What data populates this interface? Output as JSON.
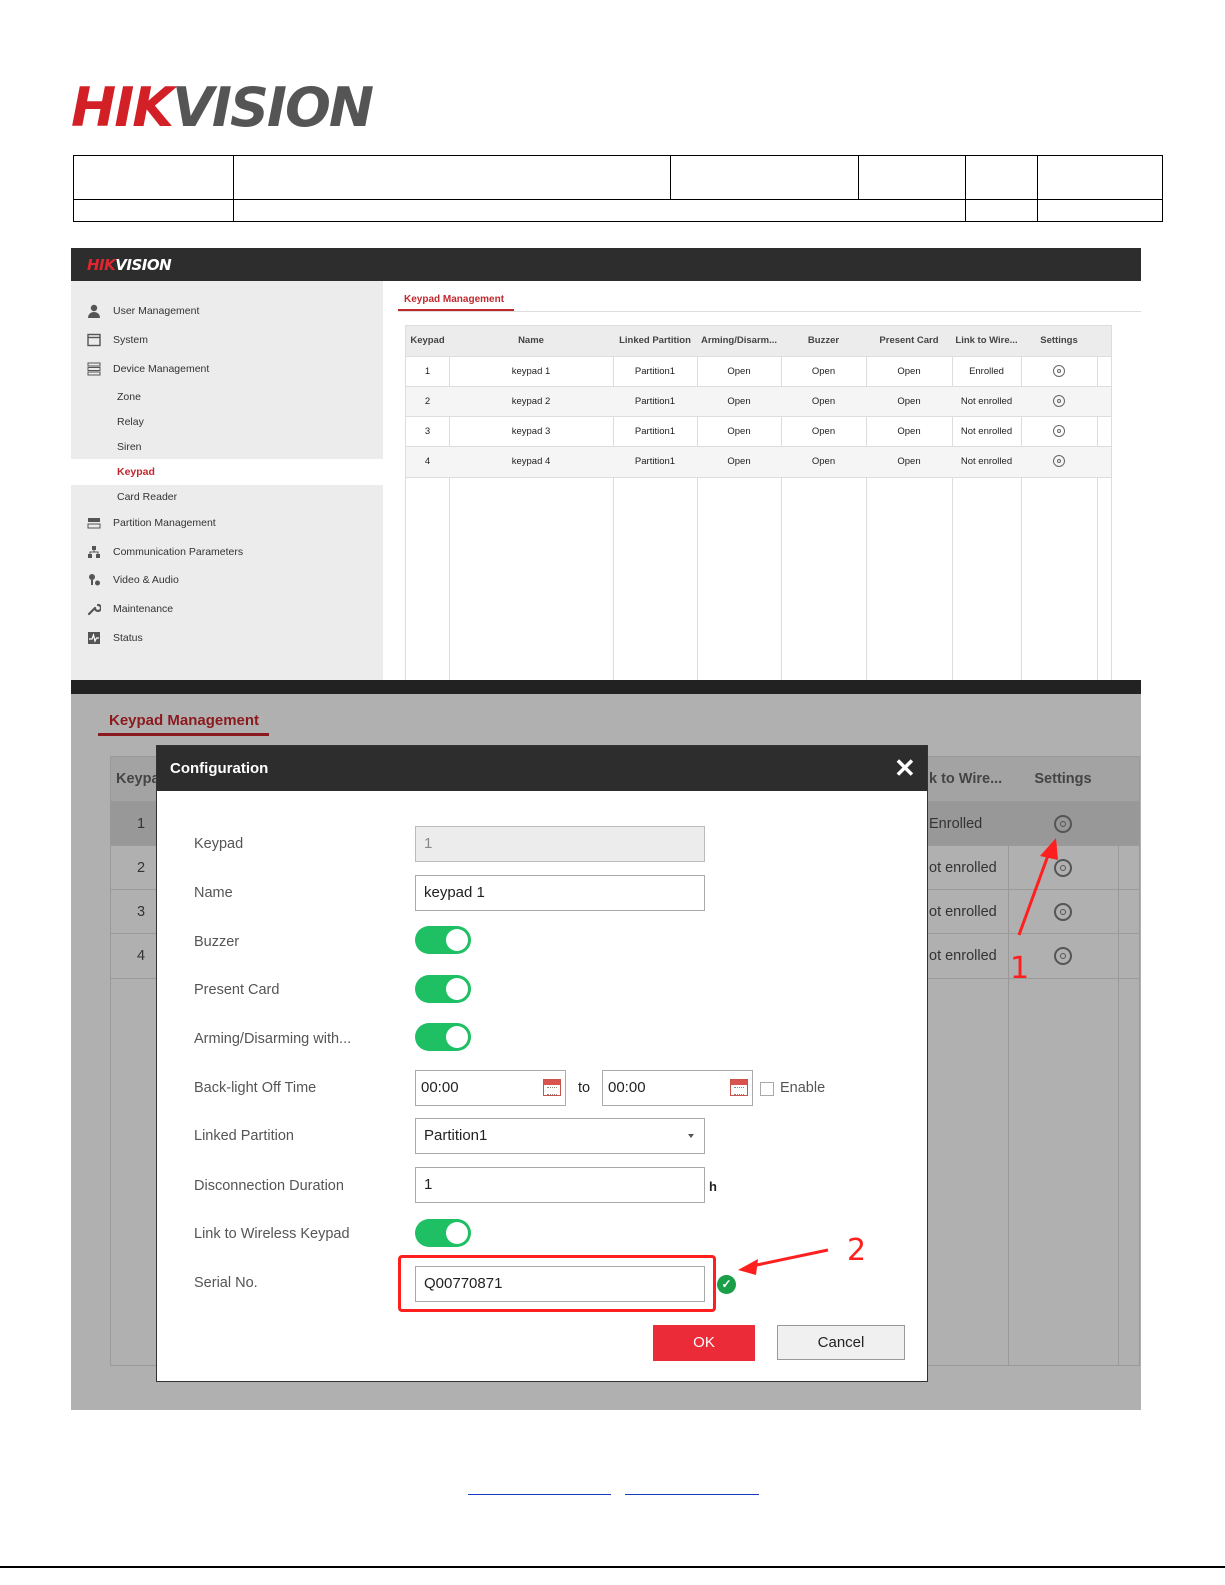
{
  "doc": {
    "logo_red": "HIK",
    "logo_gray": "VISION"
  },
  "app": {
    "logo_red": "HIK",
    "logo_white": "VISION",
    "sidebar": [
      {
        "label": "User Management",
        "icon": "user-icon",
        "level": "top"
      },
      {
        "label": "System",
        "icon": "window-icon",
        "level": "top"
      },
      {
        "label": "Device Management",
        "icon": "device-icon",
        "level": "top"
      },
      {
        "label": "Zone",
        "level": "sub"
      },
      {
        "label": "Relay",
        "level": "sub"
      },
      {
        "label": "Siren",
        "level": "sub"
      },
      {
        "label": "Keypad",
        "level": "sub",
        "active": true
      },
      {
        "label": "Card Reader",
        "level": "sub"
      },
      {
        "label": "Partition Management",
        "icon": "partition-icon",
        "level": "top"
      },
      {
        "label": "Communication Parameters",
        "icon": "network-icon",
        "level": "top"
      },
      {
        "label": "Video & Audio",
        "icon": "video-audio-icon",
        "level": "top"
      },
      {
        "label": "Maintenance",
        "icon": "wrench-icon",
        "level": "top"
      },
      {
        "label": "Status",
        "icon": "status-icon",
        "level": "top"
      }
    ],
    "tab_label": "Keypad Management",
    "columns": [
      "Keypad",
      "Name",
      "Linked Partition",
      "Arming/Disarm...",
      "Buzzer",
      "Present Card",
      "Link to Wire...",
      "Settings"
    ],
    "rows": [
      {
        "keypad": "1",
        "name": "keypad 1",
        "partition": "Partition1",
        "arming": "Open",
        "buzzer": "Open",
        "card": "Open",
        "link": "Enrolled"
      },
      {
        "keypad": "2",
        "name": "keypad 2",
        "partition": "Partition1",
        "arming": "Open",
        "buzzer": "Open",
        "card": "Open",
        "link": "Not enrolled"
      },
      {
        "keypad": "3",
        "name": "keypad 3",
        "partition": "Partition1",
        "arming": "Open",
        "buzzer": "Open",
        "card": "Open",
        "link": "Not enrolled"
      },
      {
        "keypad": "4",
        "name": "keypad 4",
        "partition": "Partition1",
        "arming": "Open",
        "buzzer": "Open",
        "card": "Open",
        "link": "Not enrolled"
      }
    ]
  },
  "background": {
    "tab_label": "Keypad Management",
    "col_keypad_partial": "Keypa",
    "col_link_partial": "k to Wire...",
    "col_settings": "Settings",
    "rows": [
      {
        "keypad": "1",
        "link_partial": "Enrolled"
      },
      {
        "keypad": "2",
        "link_partial": "ot enrolled"
      },
      {
        "keypad": "3",
        "link_partial": "ot enrolled"
      },
      {
        "keypad": "4",
        "link_partial": "ot enrolled"
      }
    ]
  },
  "dialog": {
    "title": "Configuration",
    "close_glyph": "✕",
    "labels": {
      "keypad": "Keypad",
      "name": "Name",
      "buzzer": "Buzzer",
      "present_card": "Present Card",
      "arming": "Arming/Disarming with...",
      "backlight": "Back-light Off Time",
      "linked_partition": "Linked Partition",
      "disconnection": "Disconnection Duration",
      "link_wireless": "Link to Wireless Keypad",
      "serial": "Serial No."
    },
    "values": {
      "keypad": "1",
      "name": "keypad 1",
      "buzzer_on": true,
      "present_card_on": true,
      "arming_on": true,
      "backlight_from": "00:00",
      "to_label": "to",
      "backlight_to": "00:00",
      "enable_label": "Enable",
      "enable_checked": false,
      "linked_partition": "Partition1",
      "disconnection": "1",
      "disconnection_unit": "h",
      "link_wireless_on": true,
      "serial": "Q00770871",
      "serial_valid": true
    },
    "ok_label": "OK",
    "cancel_label": "Cancel"
  },
  "annotations": {
    "step1": "1",
    "step2": "2",
    "color": "#ff1f1f"
  },
  "colors": {
    "accent": "#c0282e",
    "toggle_on": "#1fc063",
    "ok_button": "#eb2b37"
  }
}
